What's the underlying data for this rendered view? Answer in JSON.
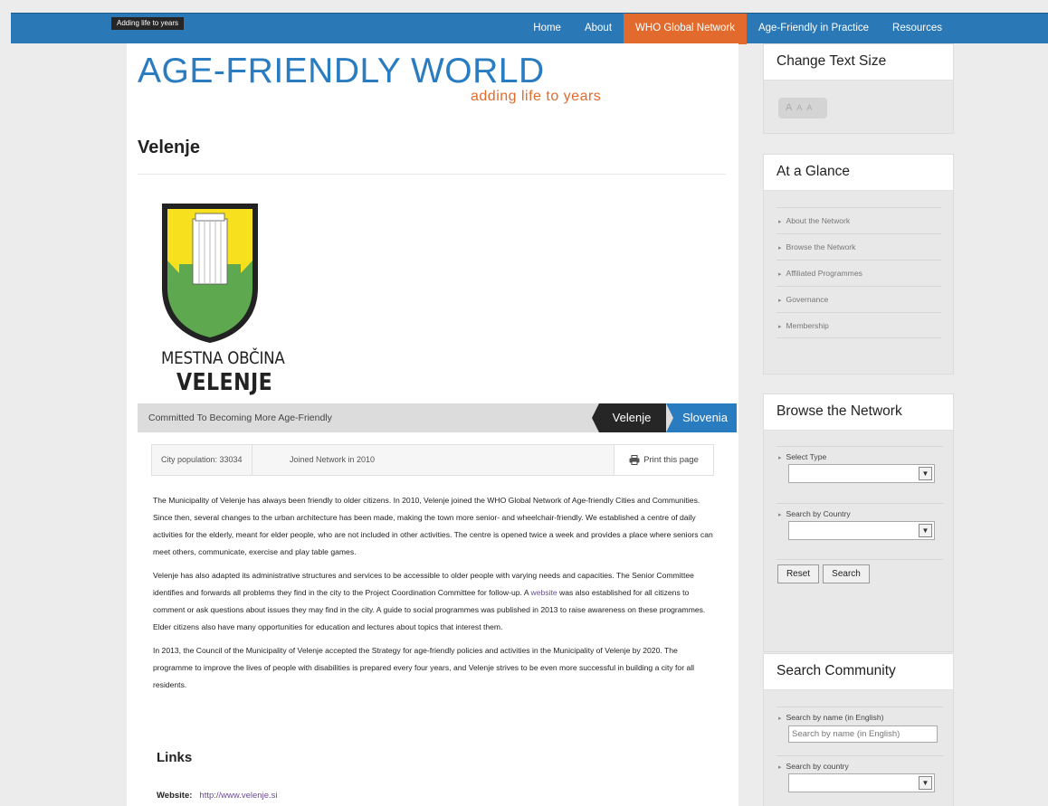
{
  "header": {
    "tagline": "Adding life to years",
    "nav": [
      "Home",
      "About",
      "WHO Global Network",
      "Age-Friendly in Practice",
      "Resources"
    ]
  },
  "brand": {
    "title": "AGE-FRIENDLY WORLD",
    "subtitle": "adding life to years"
  },
  "page": {
    "title": "Velenje",
    "crest_line1": "MESTNA OBČINA",
    "crest_line2": "VELENJE",
    "commitment": "Committed To Becoming More Age-Friendly",
    "city_tag": "Velenje",
    "country_tag": "Slovenia",
    "population": "City population: 33034",
    "joined": "Joined Network in 2010",
    "print_label": "Print this page",
    "p1": "The Municipality of Velenje has always been friendly to older citizens. In 2010, Velenje joined the WHO Global Network of Age-friendly Cities and Communities. Since then, several changes to the urban architecture has been made, making the town more senior- and wheelchair-friendly. We established a centre of daily activities for the elderly, meant for elder people, who are not included in other activities. The centre is opened twice a week and provides a place where seniors can meet others, communicate, exercise and play table games.",
    "p2_a": "Velenje has also adapted its administrative structures and services to be accessible to older people with varying needs and capacities. The Senior Committee identifies and forwards all problems they find in the city to the Project Coordination Committee for follow-up. A ",
    "p2_link": "website",
    "p2_b": " was also established for all citizens to comment or ask questions about issues they may find in the city. A guide to social programmes was published in 2013 to raise awareness on these programmes. Elder citizens also have many opportunities for education and lectures about topics that interest them.",
    "p3": "In 2013, the Council of the Municipality of Velenje accepted the Strategy for age-friendly policies and activities in the Municipality of Velenje by 2020. The programme to improve the lives of people with disabilities is prepared every four years, and Velenje strives to be even more successful in building a city for all residents.",
    "links_title": "Links",
    "website_label": "Website:",
    "website_url": "http://www.velenje.si"
  },
  "sidebar": {
    "text_size": {
      "title": "Change Text Size",
      "sizes": [
        "A",
        "A",
        "A"
      ]
    },
    "glance": {
      "title": "At a Glance",
      "items": [
        "About the Network",
        "Browse the Network",
        "Affiliated Programmes",
        "Governance",
        "Membership"
      ]
    },
    "browse": {
      "title": "Browse the Network",
      "type_label": "Select Type",
      "country_label": "Search by Country",
      "reset": "Reset",
      "search": "Search"
    },
    "community": {
      "title": "Search Community",
      "name_label": "Search by name (in English)",
      "name_placeholder": "Search by name (in English)",
      "country_label": "Search by country"
    }
  },
  "colors": {
    "nav_blue": "#2a78b5",
    "accent_orange": "#e26a2c",
    "link_purple": "#6a4c93",
    "crest_yellow": "#f7e11e",
    "crest_green": "#5ea850"
  }
}
